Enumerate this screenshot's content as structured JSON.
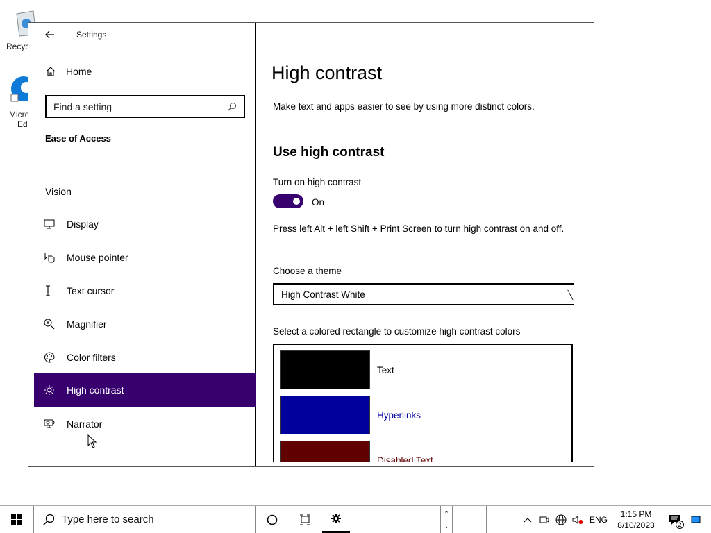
{
  "desktop": {
    "icons": [
      {
        "name": "recycle-bin",
        "label": "Recyc"
      },
      {
        "name": "edge",
        "label_line1": "Micro",
        "label_line2": "Edg"
      }
    ]
  },
  "window": {
    "app_title": "Settings",
    "controls": {
      "minimize": "minimize-icon",
      "maximize": "maximize-icon",
      "close": "close-icon"
    }
  },
  "sidebar": {
    "home_label": "Home",
    "search_placeholder": "Find a setting",
    "section_title": "Ease of Access",
    "group_title": "Vision",
    "items": [
      {
        "label": "Display",
        "icon": "display-icon"
      },
      {
        "label": "Mouse pointer",
        "icon": "mouse-pointer-icon"
      },
      {
        "label": "Text cursor",
        "icon": "text-cursor-icon"
      },
      {
        "label": "Magnifier",
        "icon": "magnifier-icon"
      },
      {
        "label": "Color filters",
        "icon": "color-filters-icon"
      },
      {
        "label": "High contrast",
        "icon": "high-contrast-icon",
        "active": true
      },
      {
        "label": "Narrator",
        "icon": "narrator-icon"
      }
    ]
  },
  "main": {
    "page_title": "High contrast",
    "description": "Make text and apps easier to see by using more distinct colors.",
    "subsection_title": "Use high contrast",
    "toggle_label": "Turn on high contrast",
    "toggle_state": "On",
    "shortcut_hint": "Press left Alt + left Shift + Print Screen to turn high contrast on and off.",
    "theme_label": "Choose a theme",
    "theme_value": "High Contrast White",
    "colors_label": "Select a colored rectangle to customize high contrast colors",
    "swatches": [
      {
        "label": "Text",
        "color": "#000000",
        "label_color": "#000000"
      },
      {
        "label": "Hyperlinks",
        "color": "#00009f",
        "label_color": "#00009f"
      },
      {
        "label": "Disabled Text",
        "color": "#600000",
        "label_color": "#600000"
      }
    ]
  },
  "taskbar": {
    "search_placeholder": "Type here to search",
    "language": "ENG",
    "time": "1:15 PM",
    "date": "8/10/2023",
    "notification_count": "2"
  },
  "colors": {
    "accent": "#37006e"
  }
}
